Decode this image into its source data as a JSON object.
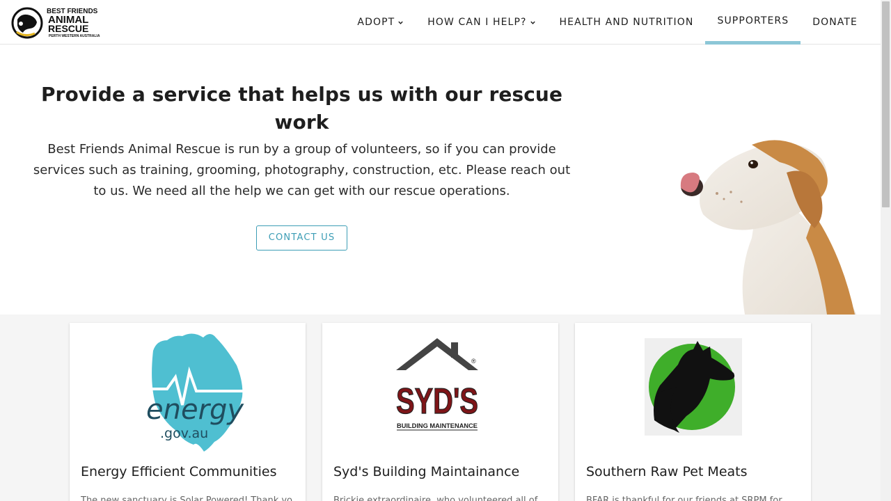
{
  "logo": {
    "line1": "BEST FRIENDS",
    "line2": "ANIMAL",
    "line3": "RESCUE",
    "line4": "PERTH WESTERN AUSTRALIA"
  },
  "nav": {
    "adopt": "ADOPT",
    "how_can_i_help": "HOW CAN I HELP?",
    "health": "HEALTH AND NUTRITION",
    "supporters": "SUPPORTERS",
    "donate": "DONATE"
  },
  "hero": {
    "title": "Provide a service that helps us with our rescue work",
    "description": "Best Friends Animal Rescue is run by a group of volunteers, so if you can provide services such as training, grooming, photography, construction, etc. Please reach out to us. We need all the help we can get with our rescue operations.",
    "button": "CONTACT US"
  },
  "cards": [
    {
      "title": "Energy Efficient Communities",
      "text": "The new sanctuary is Solar Powered! Thank you",
      "logo_main": "energy",
      "logo_sub": ".gov.au"
    },
    {
      "title": "Syd's Building Maintainance",
      "text": "Brickie extraordinaire, who volunteered all of",
      "logo_main": "SYD'S",
      "logo_sub": "BUILDING MAINTENANCE"
    },
    {
      "title": "Southern Raw Pet Meats",
      "text": "BFAR is thankful for our friends at SRPM for"
    }
  ],
  "colors": {
    "accent": "#3c9db5",
    "active_tab": "#8cc7d7",
    "energy_teal": "#4fbfd1",
    "syds_red": "#7e1518",
    "srpm_green": "#3fae2a"
  }
}
